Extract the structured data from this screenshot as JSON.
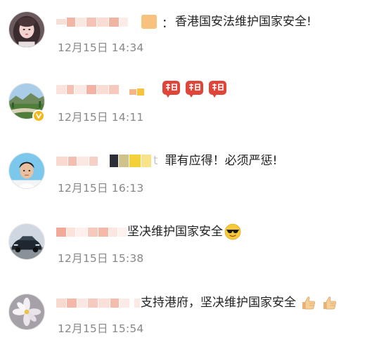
{
  "comments": [
    {
      "avatar_icon": "avatar-girl-photo-icon",
      "verified": false,
      "separator": "：",
      "text": "香港国安法维护国家安全!",
      "time": "12月15日 14:34",
      "emoji": []
    },
    {
      "avatar_icon": "avatar-landscape-photo-icon",
      "verified": true,
      "separator": "",
      "text": "",
      "time": "12月15日 14:11",
      "emoji": [
        "support-badge-icon",
        "support-badge-icon",
        "support-badge-icon"
      ]
    },
    {
      "avatar_icon": "avatar-boy-photo-icon",
      "verified": false,
      "separator": "",
      "text": "罪有应得！必须严惩!",
      "time": "12月15日 16:13",
      "emoji": []
    },
    {
      "avatar_icon": "avatar-car-photo-icon",
      "verified": false,
      "separator": "",
      "text": "坚决维护国家安全",
      "time": "12月15日 15:38",
      "emoji": [
        "sunglasses-face-icon"
      ]
    },
    {
      "avatar_icon": "avatar-flower-photo-icon",
      "verified": false,
      "separator": "",
      "text": "支持港府，坚决维护国家安全",
      "time": "12月15日 15:54",
      "emoji": [
        "thumbs-up-icon",
        "thumbs-up-icon"
      ]
    }
  ]
}
